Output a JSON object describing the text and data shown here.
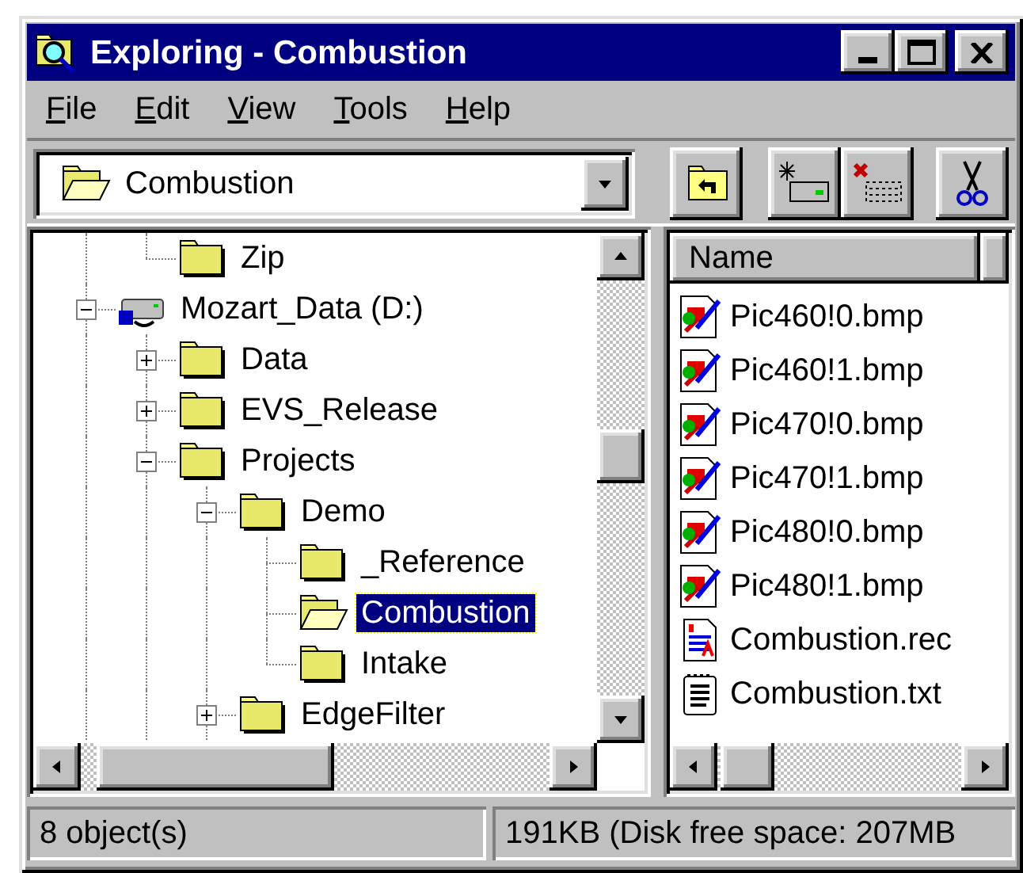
{
  "window": {
    "title": "Exploring - Combustion"
  },
  "menu": [
    {
      "label": "File"
    },
    {
      "label": "Edit"
    },
    {
      "label": "View"
    },
    {
      "label": "Tools"
    },
    {
      "label": "Help"
    }
  ],
  "address": {
    "value": "Combustion"
  },
  "toolbar": [
    {
      "kind": "up"
    },
    {
      "kind": "map-drive"
    },
    {
      "kind": "disconnect"
    },
    {
      "kind": "cut"
    }
  ],
  "tree": {
    "items": [
      {
        "children": [
          {
            "label": "Zip",
            "kind": "folder",
            "selected": false
          }
        ]
      },
      {
        "label": "Mozart_Data (D:)",
        "kind": "drive",
        "expanded": true,
        "selected": false,
        "children": [
          {
            "label": "Data",
            "kind": "folder",
            "expanded": false,
            "selected": false
          },
          {
            "label": "EVS_Release",
            "kind": "folder",
            "expanded": false,
            "selected": false
          },
          {
            "label": "Projects",
            "kind": "folder",
            "expanded": true,
            "selected": false,
            "children": [
              {
                "label": "Demo",
                "kind": "folder",
                "expanded": true,
                "selected": false,
                "children": [
                  {
                    "label": "_Reference",
                    "kind": "folder",
                    "selected": false
                  },
                  {
                    "label": "Combustion",
                    "kind": "folder",
                    "selected": true
                  },
                  {
                    "label": "Intake",
                    "kind": "folder",
                    "selected": false
                  }
                ]
              },
              {
                "label": "EdgeFilter",
                "kind": "folder",
                "expanded": false,
                "selected": false
              }
            ]
          }
        ]
      }
    ]
  },
  "files": {
    "columns": [
      "Name"
    ],
    "rows": [
      {
        "name": "Pic460!0.bmp",
        "kind": "bitmap"
      },
      {
        "name": "Pic460!1.bmp",
        "kind": "bitmap"
      },
      {
        "name": "Pic470!0.bmp",
        "kind": "bitmap"
      },
      {
        "name": "Pic470!1.bmp",
        "kind": "bitmap"
      },
      {
        "name": "Pic480!0.bmp",
        "kind": "bitmap"
      },
      {
        "name": "Pic480!1.bmp",
        "kind": "bitmap"
      },
      {
        "name": "Combustion.rec",
        "kind": "record"
      },
      {
        "name": "Combustion.txt",
        "kind": "text"
      }
    ]
  },
  "status_bar": [
    "8 object(s)",
    "191KB (Disk free space: 207MB"
  ]
}
